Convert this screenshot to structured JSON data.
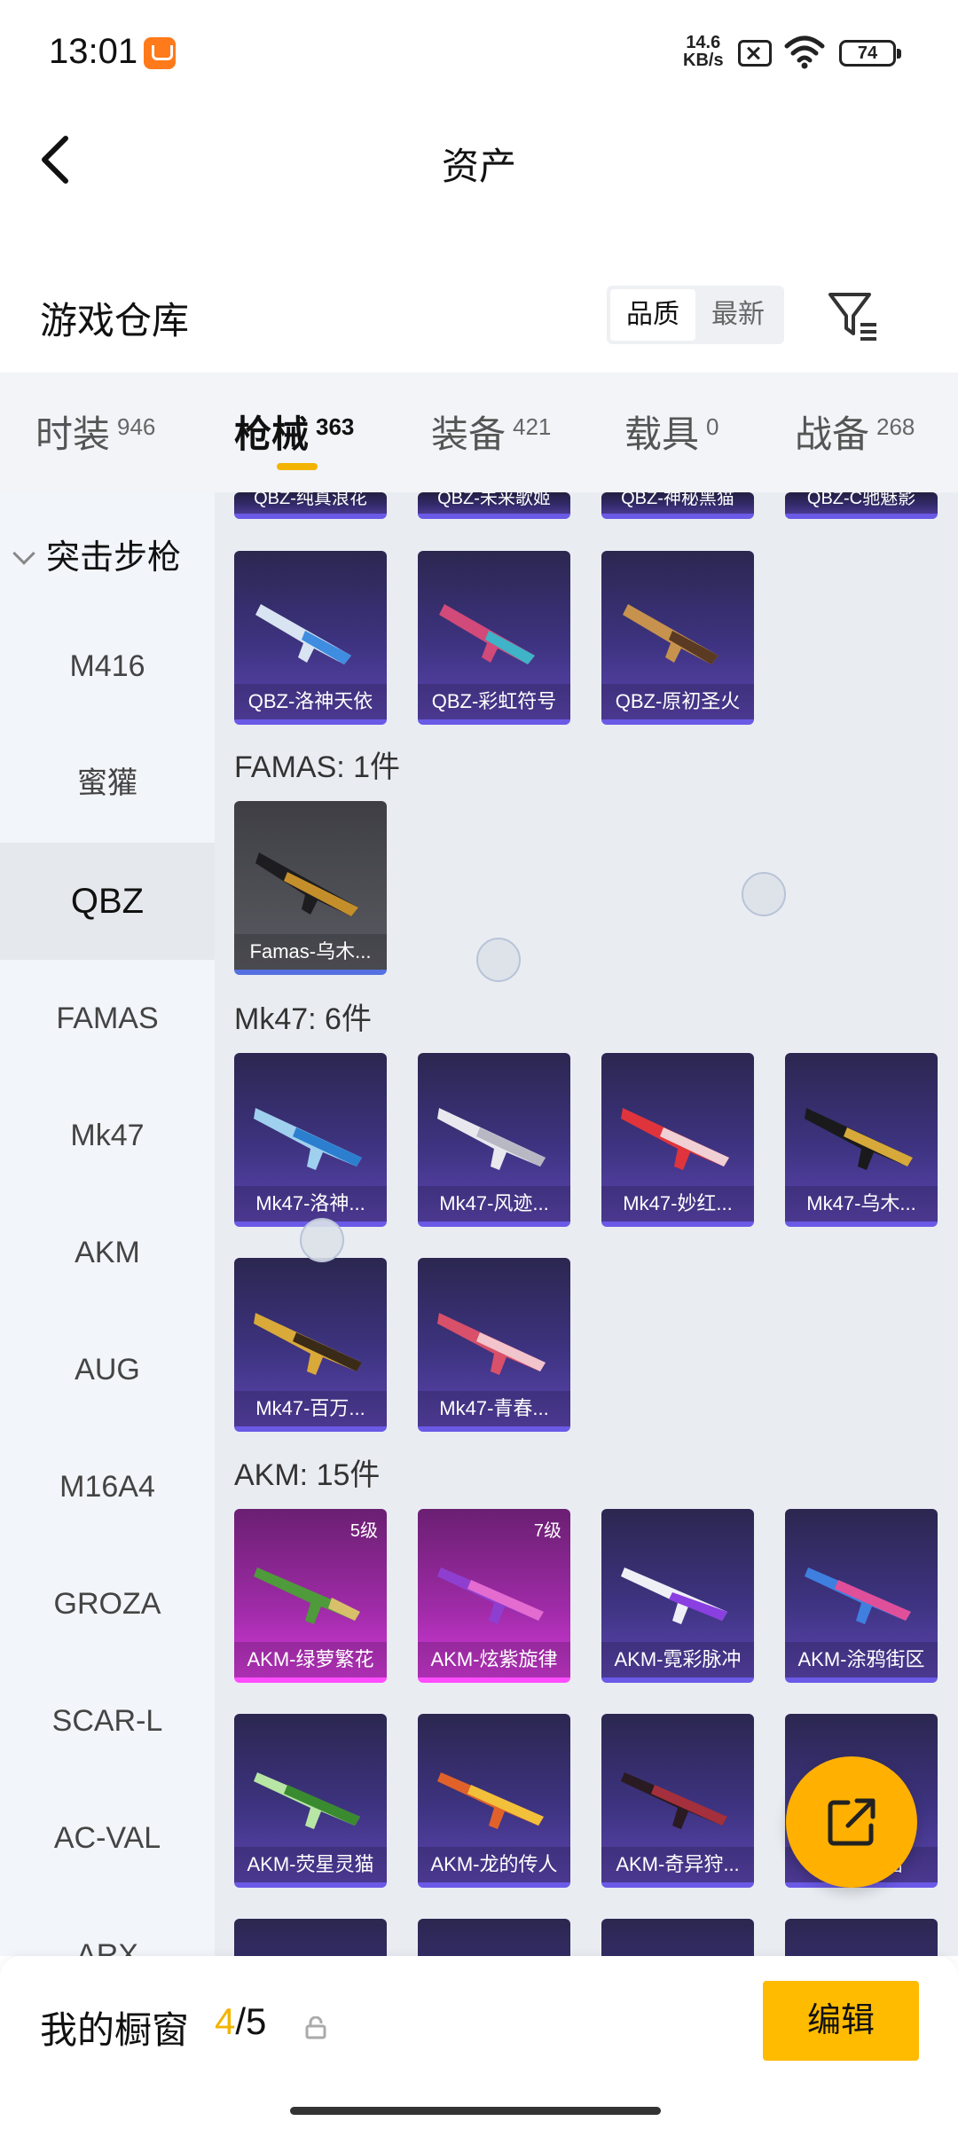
{
  "status_bar": {
    "time": "13:01",
    "net_speed_value": "14.6",
    "net_speed_unit": "KB/s",
    "battery": "74",
    "icons": [
      "app-badge-icon",
      "sim-off-icon",
      "wifi-icon",
      "battery-icon"
    ]
  },
  "header": {
    "title": "资产",
    "back_icon": "chevron-left-icon"
  },
  "warehouse": {
    "title": "游戏仓库",
    "sort_options": [
      "品质",
      "最新"
    ],
    "active_sort": "品质",
    "filter_icon": "filter-icon"
  },
  "tabs": [
    {
      "label": "时装",
      "count": "946"
    },
    {
      "label": "枪械",
      "count": "363"
    },
    {
      "label": "装备",
      "count": "421"
    },
    {
      "label": "载具",
      "count": "0"
    },
    {
      "label": "战备",
      "count": "268"
    }
  ],
  "active_tab": "枪械",
  "accent_color": "#f2b400",
  "sidebar": {
    "group": "突击步枪",
    "items": [
      "M416",
      "蜜獾",
      "QBZ",
      "FAMAS",
      "Mk47",
      "AKM",
      "AUG",
      "M16A4",
      "GROZA",
      "SCAR-L",
      "AC-VAL",
      "ARX"
    ],
    "active": "QBZ"
  },
  "content": {
    "top_partial_cards": [
      "QBZ-纯真浪花",
      "QBZ-未来歌姬",
      "QBZ-神秘黑猫",
      "QBZ-C驰魅影"
    ],
    "qbz_cards": [
      "QBZ-洛神天依",
      "QBZ-彩虹符号",
      "QBZ-原初圣火"
    ],
    "famas_title": "FAMAS: 1件",
    "famas_cards": [
      "Famas-乌木..."
    ],
    "mk47_title": "Mk47: 6件",
    "mk47_cards": [
      "Mk47-洛神...",
      "Mk47-风迹...",
      "Mk47-妙红...",
      "Mk47-乌木...",
      "Mk47-百万...",
      "Mk47-青春..."
    ],
    "akm_title": "AKM: 15件",
    "akm_cards": [
      {
        "name": "AKM-绿萝繁花",
        "level": "5级"
      },
      {
        "name": "AKM-炫紫旋律",
        "level": "7级"
      },
      {
        "name": "AKM-霓彩脉冲",
        "level": ""
      },
      {
        "name": "AKM-涂鸦街区",
        "level": ""
      },
      {
        "name": "AKM-荧星灵猫",
        "level": ""
      },
      {
        "name": "AKM-龙的传人",
        "level": ""
      },
      {
        "name": "AKM-奇异狩...",
        "level": ""
      },
      {
        "name": "AKM-...岩",
        "level": ""
      }
    ]
  },
  "fab_icon": "share-icon",
  "bottom_bar": {
    "label": "我的橱窗",
    "current": "4",
    "total": "/5",
    "lock_icon": "lock-icon",
    "edit_label": "编辑"
  }
}
